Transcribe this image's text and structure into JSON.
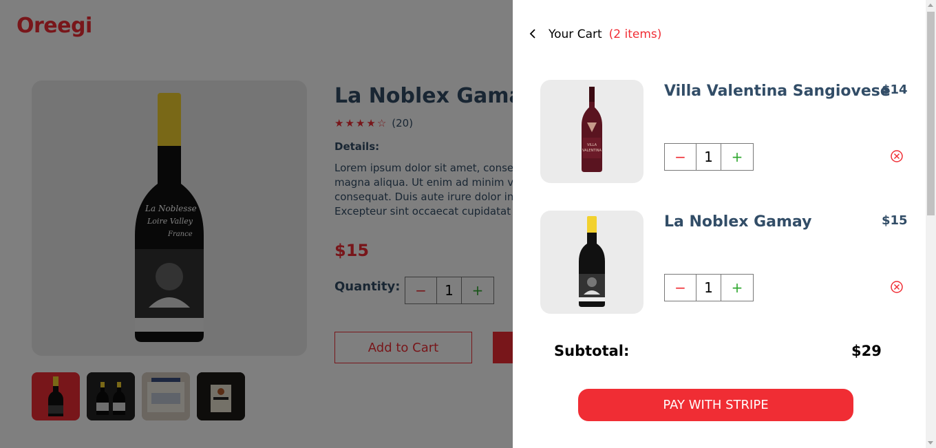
{
  "brand": {
    "logo": "Oreegi"
  },
  "product": {
    "title": "La Noblex Gamay",
    "rating_count": "(20)",
    "details_label": "Details:",
    "details_lines": [
      "Lorem ipsum dolor sit amet, consecte",
      "magna aliqua. Ut enim ad minim ven",
      "consequat. Duis aute irure dolor in re",
      "Excepteur sint occaecat cupidatat no"
    ],
    "price": "$15",
    "quantity_label": "Quantity:",
    "quantity": "1",
    "add_to_cart_label": "Add to Cart",
    "stars_filled": 4,
    "stars_total": 5
  },
  "cart": {
    "title": "Your Cart",
    "item_count": "(2 items)",
    "items": [
      {
        "name": "Villa Valentina Sangiovese",
        "price": "$14",
        "quantity": "1"
      },
      {
        "name": "La Noblex Gamay",
        "price": "$15",
        "quantity": "1"
      }
    ],
    "subtotal_label": "Subtotal:",
    "subtotal_value": "$29",
    "pay_label": "PAY WITH STRIPE"
  },
  "colors": {
    "accent": "#f02d34",
    "text": "#324d67",
    "plus": "#31a831"
  }
}
